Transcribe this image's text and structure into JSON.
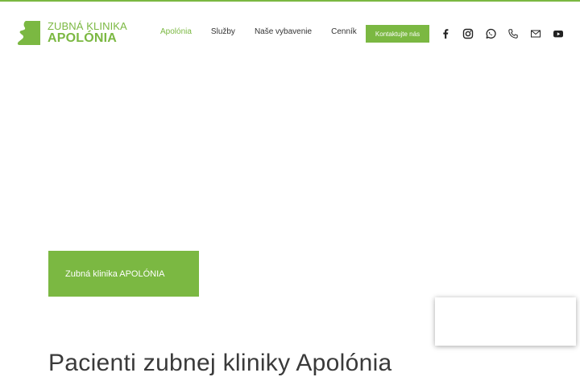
{
  "header": {
    "logo": {
      "line1": "ZUBNÁ KLINIKA",
      "line2": "APOLÓNIA"
    },
    "nav": [
      {
        "label": "Apolónia",
        "active": true
      },
      {
        "label": "Služby",
        "active": false
      },
      {
        "label": "Naše vybavenie",
        "active": false
      },
      {
        "label": "Cenník",
        "active": false
      }
    ],
    "cta_label": "Kontaktujte nás",
    "social_icons": [
      "facebook-icon",
      "instagram-icon",
      "whatsapp-icon",
      "phone-icon",
      "mail-icon",
      "youtube-icon"
    ]
  },
  "hero": {
    "badge_text": "Zubná klinika APOLÓNIA"
  },
  "section": {
    "headline": "Pacienti zubnej kliniky Apolónia"
  },
  "colors": {
    "accent": "#7bb842",
    "text": "#333333",
    "background": "#ffffff"
  }
}
